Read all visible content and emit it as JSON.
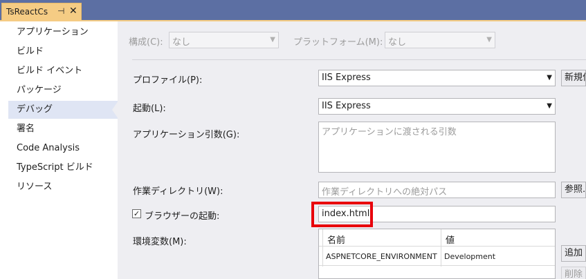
{
  "tab": {
    "title": "TsReactCs",
    "pin_icon": "⊣",
    "close_icon": "✕"
  },
  "sidebar": {
    "items": [
      {
        "label": "アプリケーション"
      },
      {
        "label": "ビルド"
      },
      {
        "label": "ビルド イベント"
      },
      {
        "label": "パッケージ"
      },
      {
        "label": "デバッグ",
        "active": true
      },
      {
        "label": "署名"
      },
      {
        "label": "Code Analysis"
      },
      {
        "label": "TypeScript ビルド"
      },
      {
        "label": "リソース"
      }
    ]
  },
  "config": {
    "configuration_label": "構成(C):",
    "configuration_value": "なし",
    "platform_label": "プラットフォーム(M):",
    "platform_value": "なし"
  },
  "debug": {
    "profile_label": "プロファイル(P):",
    "profile_value": "IIS Express",
    "new_button": "新規作成",
    "launch_label": "起動(L):",
    "launch_value": "IIS Express",
    "app_args_label": "アプリケーション引数(G):",
    "app_args_placeholder": "アプリケーションに渡される引数",
    "workdir_label": "作業ディレクトリ(W):",
    "workdir_placeholder": "作業ディレクトリへの絶対パス",
    "browse_button": "参照...",
    "launch_browser_label": "ブラウザーの起動:",
    "launch_browser_checked": true,
    "launch_browser_value": "index.html",
    "env_label": "環境変数(M):",
    "env_columns": [
      "名前",
      "値"
    ],
    "env_rows": [
      {
        "name": "ASPNETCORE_ENVIRONMENT",
        "value": "Development"
      }
    ],
    "add_button": "追加",
    "delete_button": "削除"
  },
  "colors": {
    "highlight": "#e8000b",
    "tab": "#f5cc84",
    "titlebar": "#5c6fa3"
  }
}
